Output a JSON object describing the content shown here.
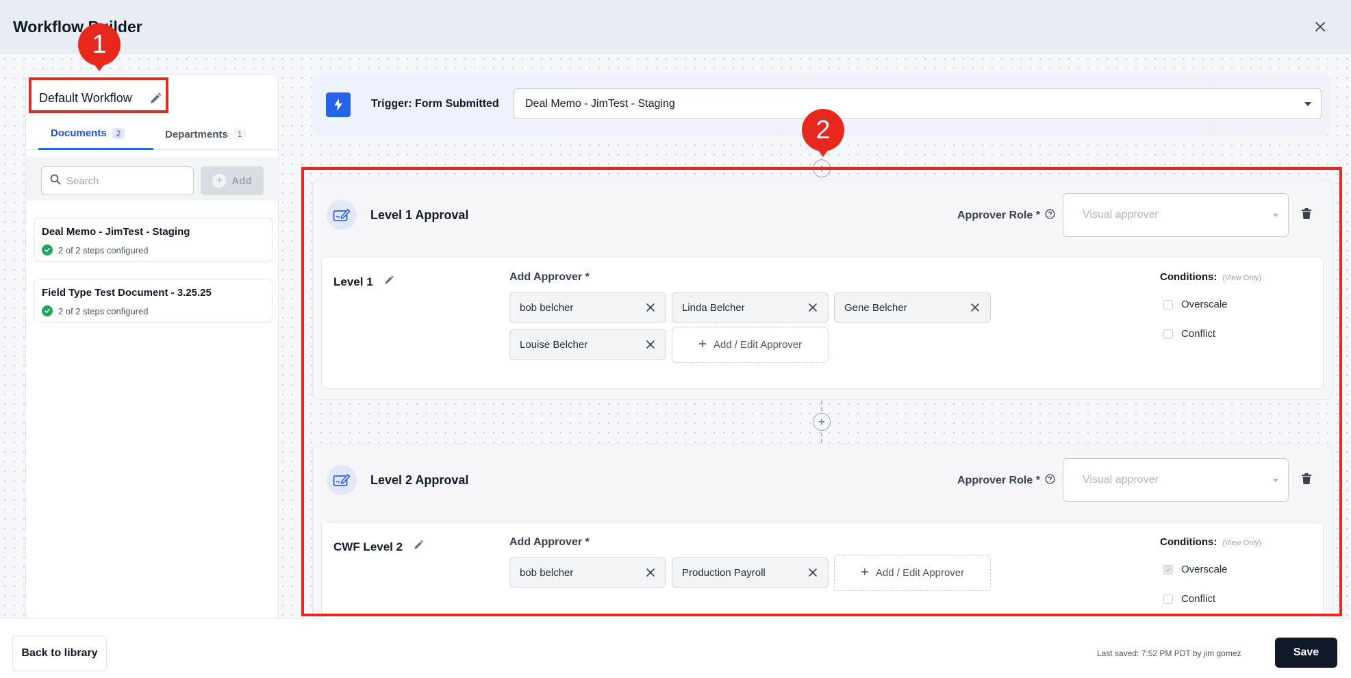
{
  "header": {
    "title": "Workflow Builder",
    "close_icon": "close-icon"
  },
  "sidebar": {
    "workflow_name": "Default Workflow",
    "tabs": [
      {
        "label": "Documents",
        "count": "2",
        "active": true
      },
      {
        "label": "Departments",
        "count": "1",
        "active": false
      }
    ],
    "search": {
      "placeholder": "Search",
      "value": ""
    },
    "add_label": "Add",
    "documents": [
      {
        "name": "Deal Memo - JimTest - Staging",
        "status": "2 of 2 steps configured"
      },
      {
        "name": "Field Type Test Document - 3.25.25",
        "status": "2 of 2 steps configured"
      }
    ]
  },
  "trigger": {
    "label": "Trigger: Form Submitted",
    "selected": "Deal Memo - JimTest - Staging"
  },
  "levels": [
    {
      "title": "Level 1 Approval",
      "approver_role_label": "Approver Role *",
      "approver_role_placeholder": "Visual approver",
      "step_name": "Level 1",
      "add_approver_label": "Add Approver *",
      "approvers": [
        "bob belcher",
        "Linda Belcher",
        "Gene Belcher",
        "Louise Belcher"
      ],
      "add_edit_label": "Add / Edit Approver",
      "conditions_label": "Conditions:",
      "conditions_note": "(View Only)",
      "conditions": [
        {
          "label": "Overscale",
          "checked": false
        },
        {
          "label": "Conflict",
          "checked": false
        }
      ]
    },
    {
      "title": "Level 2 Approval",
      "approver_role_label": "Approver Role *",
      "approver_role_placeholder": "Visual approver",
      "step_name": "CWF Level 2",
      "add_approver_label": "Add Approver *",
      "approvers": [
        "bob belcher",
        "Production Payroll"
      ],
      "add_edit_label": "Add / Edit Approver",
      "conditions_label": "Conditions:",
      "conditions_note": "(View Only)",
      "conditions": [
        {
          "label": "Overscale",
          "checked": true
        },
        {
          "label": "Conflict",
          "checked": false
        }
      ]
    }
  ],
  "annotations": [
    "1",
    "2"
  ],
  "footer": {
    "back_label": "Back to library",
    "last_saved": "Last saved: 7:52 PM PDT by jim gomez",
    "save_label": "Save"
  },
  "colors": {
    "accent": "#2563eb",
    "annotation": "#e8281d",
    "success": "#22a55a",
    "save_button": "#111827"
  }
}
